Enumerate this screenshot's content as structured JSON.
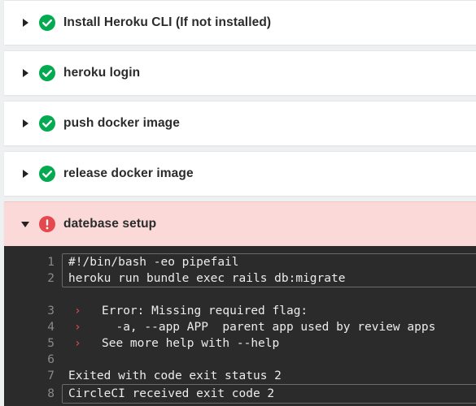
{
  "steps": [
    {
      "title": "Install Heroku CLI (If not installed)",
      "status": "success",
      "expanded": false
    },
    {
      "title": "heroku login",
      "status": "success",
      "expanded": false
    },
    {
      "title": "push docker image",
      "status": "success",
      "expanded": false
    },
    {
      "title": "release docker image",
      "status": "success",
      "expanded": false
    },
    {
      "title": "datebase setup",
      "status": "failed",
      "expanded": true
    }
  ],
  "terminal": {
    "lines": [
      {
        "n": "1",
        "text": "#!/bin/bash -eo pipefail"
      },
      {
        "n": "2",
        "text": "heroku run bundle exec rails db:migrate"
      },
      {
        "n": "3",
        "marker": "›",
        "text": "Error: Missing required flag:"
      },
      {
        "n": "4",
        "marker": "›",
        "text": "  -a, --app APP  parent app used by review apps"
      },
      {
        "n": "5",
        "marker": "›",
        "text": "See more help with --help"
      },
      {
        "n": "6",
        "text": ""
      },
      {
        "n": "7",
        "text": "Exited with code exit status 2"
      },
      {
        "n": "8",
        "text": "CircleCI received exit code 2"
      }
    ]
  },
  "colors": {
    "success": "#04aa51",
    "failed": "#e5484d",
    "failed_bg": "#fbd9d9",
    "terminal_bg": "#2b2b2b"
  },
  "icons": {
    "collapsed": "caret-right-icon",
    "expanded": "caret-down-icon",
    "success": "check-circle-icon",
    "failed": "exclamation-circle-icon"
  }
}
